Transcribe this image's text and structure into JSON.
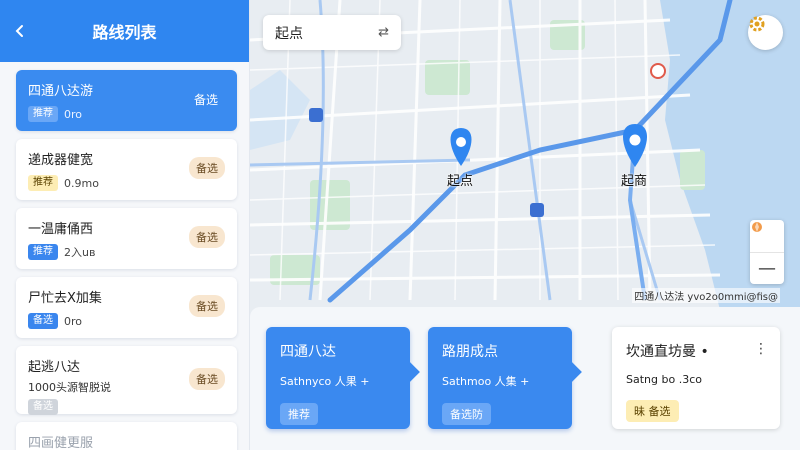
{
  "left": {
    "title": "路线列表",
    "routes": [
      {
        "title": "四通八达游",
        "tag": "推荐",
        "info": "0ro",
        "badge": "备选"
      },
      {
        "title": "递成器健宽",
        "tag": "推荐",
        "info": "0.9mo",
        "badge": "备选"
      },
      {
        "title": "一温庸俑西",
        "tag": "推荐",
        "info": "2入uв",
        "badge": "备选"
      },
      {
        "title": "尸忙去X加集",
        "tag": "备选",
        "info": "0ro",
        "badge": "备选"
      },
      {
        "title": "起逃八达",
        "subtitle": "1000头源智脱说",
        "tag": "备选",
        "badge": "备选"
      },
      {
        "title": "四画健更服"
      }
    ]
  },
  "map": {
    "search_text": "起点",
    "start_label": "起点",
    "end_label": "起商",
    "attribution": "四通八达法 yvo2o0mmi@fis@"
  },
  "cards": [
    {
      "title": "四通八达",
      "sub": "Sathnyco 人果 +",
      "tag": "推荐"
    },
    {
      "title": "路朋成点",
      "sub": "Sathmoo 人集 +",
      "tag": "备选防"
    },
    {
      "title": "坎通直坊曼 •",
      "sub": "Satng bo .3co",
      "tag": "昧 备选"
    }
  ],
  "colors": {
    "accent": "#2f86f0",
    "road": "#8fb9ef",
    "water": "#bcd8f2",
    "park": "#cde8d2"
  },
  "icons": [
    "back-arrow-icon",
    "swap-icon",
    "settings-gear-icon",
    "location-pin-icon",
    "compass-icon",
    "zoom-out-icon",
    "more-icon"
  ]
}
